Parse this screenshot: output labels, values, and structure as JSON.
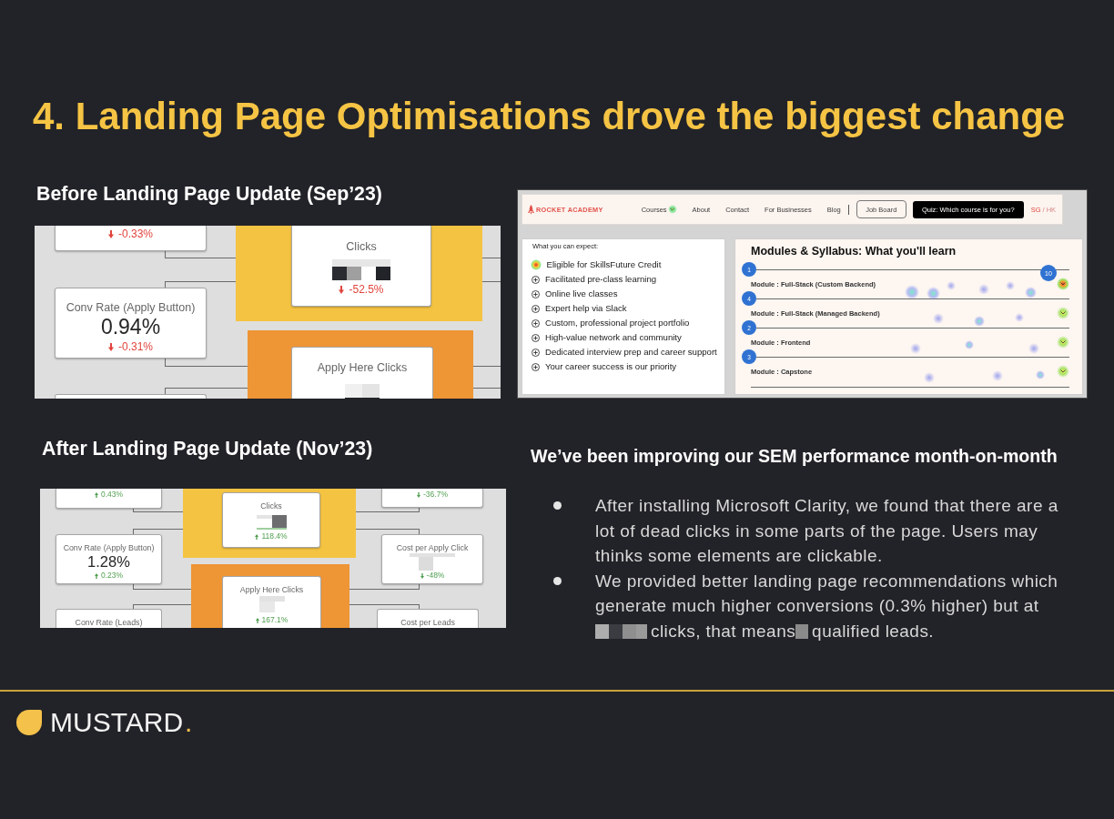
{
  "title": "4. Landing Page Optimisations drove the biggest change",
  "before": {
    "heading": "Before Landing Page Update (Sep’23)",
    "left_cards": [
      {
        "kind": "metric",
        "change": "-0.33%",
        "increase": false,
        "positive": false
      },
      {
        "kind": "metric",
        "label": "Conv Rate (Apply Button)",
        "value": "0.94%",
        "change": "-0.31%",
        "increase": false,
        "positive": false,
        "redacted": false
      },
      {
        "kind": "blank"
      }
    ],
    "panels": [
      {
        "color": "#f4c342",
        "card": {
          "kind": "metric",
          "label": "Clicks",
          "redacted": true,
          "change": "-52.5%",
          "increase": false,
          "positive": false
        }
      },
      {
        "color": "#ee9535",
        "card": {
          "kind": "metric",
          "label": "Apply Here Clicks",
          "redacted": true
        }
      }
    ]
  },
  "heatmap": {
    "nav": {
      "brand": "ROCKET ACADEMY",
      "links": [
        {
          "label": "Courses",
          "dropdown": true
        },
        {
          "label": "About",
          "dropdown": false
        },
        {
          "label": "Contact",
          "dropdown": false
        },
        {
          "label": "For Businesses",
          "dropdown": false
        },
        {
          "label": "Blog",
          "dropdown": false
        }
      ],
      "job_board_button": "Job Board",
      "quiz_button": "Quiz: Which course is for you?",
      "regions": [
        {
          "label": "SG",
          "selected": true
        },
        {
          "label": "HK",
          "selected": false
        }
      ],
      "region_separator": "/"
    },
    "expect": {
      "heading": "What you can expect:",
      "items": [
        "Eligible for SkillsFuture Credit",
        "Facilitated pre-class learning",
        "Online live classes",
        "Expert help via Slack",
        "Custom, professional project portfolio",
        "High-value network and community",
        "Dedicated interview prep and career support",
        "Your career success is our priority"
      ]
    },
    "modules": {
      "heading": "Modules & Syllabus: What you'll learn",
      "rows": [
        {
          "number": "1",
          "label": "Module : Full-Stack (Custom Backend)"
        },
        {
          "number": "4",
          "label": "Module : Full-Stack (Managed Backend)"
        },
        {
          "number": "2",
          "label": "Module : Frontend"
        },
        {
          "number": "3",
          "label": "Module : Capstone"
        }
      ],
      "click_count": "10"
    }
  },
  "after": {
    "heading": "After Landing Page Update (Nov’23)",
    "left_cards": [
      {
        "kind": "metric",
        "change": "0.43%",
        "increase": true,
        "positive": true
      },
      {
        "kind": "metric",
        "label": "Conv Rate (Apply Button)",
        "value": "1.28%",
        "change": "0.23%",
        "increase": true,
        "positive": true,
        "redacted": false
      },
      {
        "kind": "metric",
        "label": "Conv Rate (Leads)"
      }
    ],
    "panels": [
      {
        "color": "#f4c342",
        "card": {
          "kind": "metric",
          "label": "Clicks",
          "redacted": true,
          "change": "118.4%",
          "increase": true,
          "positive": true
        }
      },
      {
        "color": "#ee9535",
        "card": {
          "kind": "metric",
          "label": "Apply Here Clicks",
          "redacted": true,
          "change": "167.1%",
          "increase": true,
          "positive": true
        }
      }
    ],
    "right_cards": [
      {
        "kind": "metric",
        "change": "-36.7%",
        "increase": false,
        "positive": true
      },
      {
        "kind": "metric",
        "label": "Cost per Apply Click",
        "redacted": true,
        "change": "-48%",
        "increase": false,
        "positive": true
      },
      {
        "kind": "metric",
        "label": "Cost per Leads"
      }
    ]
  },
  "summary": {
    "heading": "We’ve been improving our SEM performance month-on-month",
    "bullets": [
      {
        "parts": [
          "After installing Microsoft Clarity, we found that there are a lot of dead clicks in some parts of the page. Users may thinks some elements are clickable."
        ]
      },
      {
        "parts": [
          "We provided better landing page recommendations which generate much higher conversions (0.3% higher) but at",
          "clicks, that means",
          "qualified leads."
        ]
      }
    ]
  },
  "logo": {
    "name": "MUSTARD",
    "dot": "."
  }
}
